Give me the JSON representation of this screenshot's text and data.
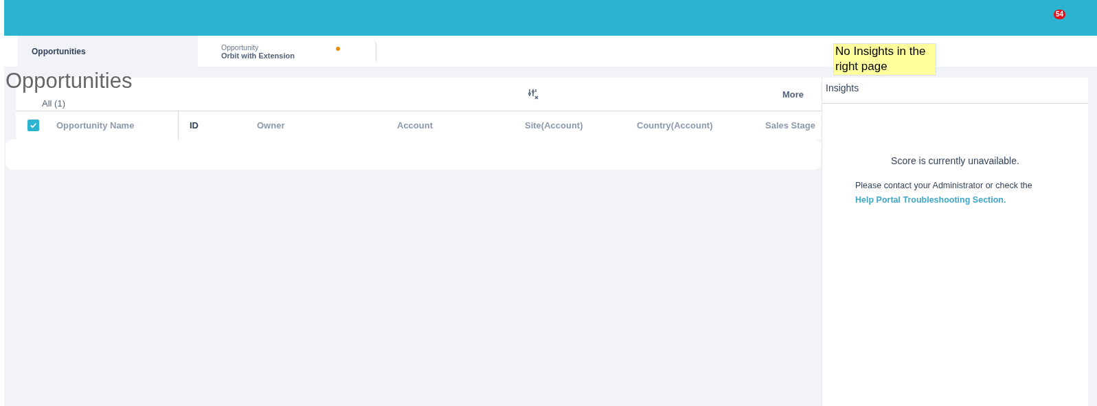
{
  "notification_badge": "54",
  "tabs": [
    {
      "label": "Opportunities",
      "selected": true
    },
    {
      "caption": "Opportunity",
      "label": "Orbit with Extension",
      "selected": false,
      "unsaved": true
    }
  ],
  "note": {
    "text": "No Insights in the right page"
  },
  "page_title": "Opportunities",
  "list": {
    "view": "All",
    "count": "(1)",
    "more": "More",
    "select_all": {
      "checked": true
    },
    "columns": [
      "Opportunity Name",
      "ID",
      "Owner",
      "Account",
      "Site(Account)",
      "Country(Account)",
      "Sales Stage"
    ]
  },
  "insights": {
    "title": "Insights",
    "status": "Score is currently unavailable.",
    "message": "Please contact your Administrator or check the",
    "link": "Help Portal Troubleshooting Section."
  }
}
